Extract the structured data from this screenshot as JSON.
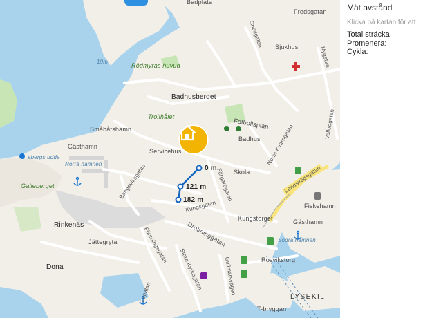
{
  "panel": {
    "title": "Mät avstånd",
    "hint": "Klicka på kartan för att",
    "total_label": "Total sträcka",
    "walk_label": "Promenera:",
    "bike_label": "Cykla:"
  },
  "route": {
    "points": [
      "0 m",
      "121 m",
      "182 m"
    ]
  },
  "map_labels": {
    "badplats": "Badplats",
    "fredsgatan": "Fredsgatan",
    "snedgatan": "Snedgatan",
    "sjukhus": "Sjukhus",
    "nygatan": "Nygatan",
    "depth_19m": "19m",
    "rodmyras_huvud": "Rödmyras huvud",
    "badhusberget": "Badhusberget",
    "trollhalet": "Trollhålet",
    "fotbollsplan": "Fotbollsplan",
    "badhus": "Badhus",
    "smabatshamn": "Småbåtshamn",
    "gasthamn": "Gästhamn",
    "servicehus": "Servicehus",
    "norra_kvarngatan": "Norra Kvarngatan",
    "vallbogatan": "Vallbogatan",
    "lebergs_udde": "ebergs udde",
    "norra_hamnen": "Norra hamnen",
    "skola": "Skola",
    "bangsviksgatan": "Bangsviksgatan",
    "fargaregatan": "Färgaregatan",
    "landsvagsgatan": "Landsvägsgatan",
    "galleberget": "Galleberget",
    "kungsgatan": "Kungsgatan",
    "fiskehamn": "Fiskehamn",
    "kungstorget": "Kungstorget",
    "gasthamn2": "Gästhamn",
    "rinkenas": "Rinkenäs",
    "drottninggatan": "Drottninggatan",
    "sodra_hamnen": "Södra hamnen",
    "foreningsgatan": "Föreningsgatan",
    "jattegryta": "Jättegryta",
    "rosvikstorg": "Rosvikstorg",
    "stora_kyrkogatan": "Stora Kyrkogatan",
    "dona": "Dona",
    "gullmarsvagen": "Gullmarsvägen",
    "lagatan": "Lagatan",
    "lysekil": "LYSEKIL",
    "t_bryggan": "T-bryggan"
  },
  "colors": {
    "water": "#a9d3ed",
    "land": "#f2efe9",
    "park": "#c8e6b5",
    "road": "#ffffff",
    "route": "#1565c0",
    "home_marker": "#f2b400",
    "main_road": "#f8e47a"
  },
  "icons": {
    "home": "home-icon",
    "hospital": "hospital-cross-icon",
    "sports": "runner-icon",
    "anchor": "anchor-icon",
    "swimmer": "swimmer-icon",
    "fuel": "fuel-icon",
    "ev_charging": "ev-charging-icon",
    "bus": "bus-icon"
  }
}
